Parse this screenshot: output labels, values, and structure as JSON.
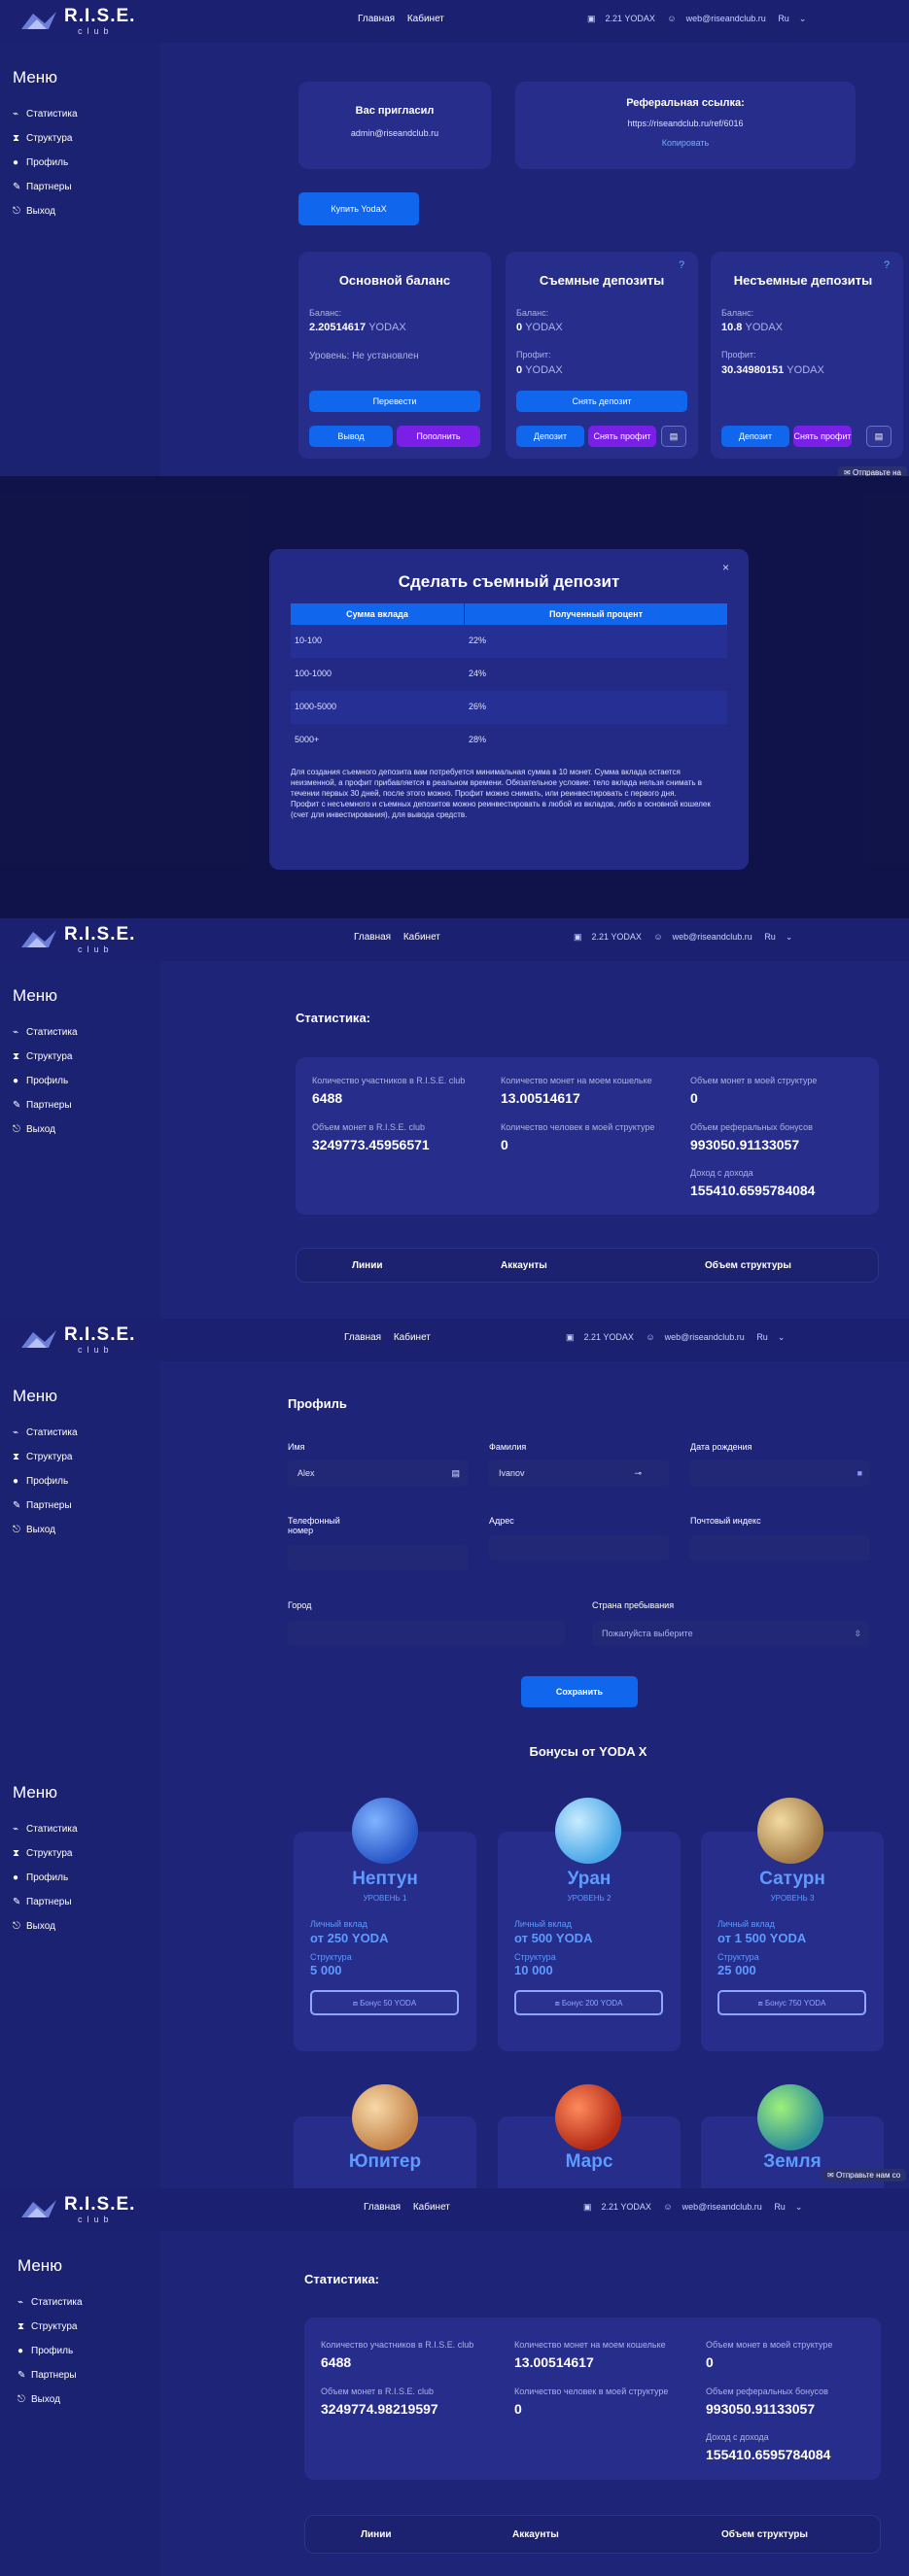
{
  "brand": {
    "name": "R.I.S.E.",
    "sub": "club"
  },
  "nav": {
    "home": "Главная",
    "cabinet": "Кабинет"
  },
  "header": {
    "balance": "2.21 YODAX",
    "email": "web@riseandclub.ru",
    "lang": "Ru"
  },
  "menu": {
    "title": "Меню",
    "items": [
      {
        "label": "Статистика",
        "icon": "chart-icon"
      },
      {
        "label": "Структура",
        "icon": "structure-icon"
      },
      {
        "label": "Профиль",
        "icon": "profile-icon"
      },
      {
        "label": "Партнеры",
        "icon": "partners-icon"
      },
      {
        "label": "Выход",
        "icon": "exit-icon"
      }
    ]
  },
  "cabinet": {
    "invited_title": "Вас пригласил",
    "invited_email": "admin@riseandclub.ru",
    "ref_title": "Реферальная ссылка:",
    "ref_link": "https://riseandclub.ru/ref/6016",
    "copy": "Копировать",
    "buy": "Купить YodaX",
    "main": {
      "title": "Основной баланс",
      "balance_label": "Баланс:",
      "balance": "2.20514617",
      "unit": "YODAX",
      "level": "Уровень: Не установлен",
      "transfer": "Перевести",
      "withdraw": "Вывод",
      "topup": "Пополнить"
    },
    "removable": {
      "title": "Съемные депозиты",
      "balance_label": "Баланс:",
      "balance": "0",
      "profit_label": "Профит:",
      "profit": "0",
      "unit": "YODAX",
      "withdraw_dep": "Снять депозит",
      "deposit": "Депозит",
      "withdraw_profit": "Снять профит"
    },
    "fixed": {
      "title": "Несъемные депозиты",
      "balance_label": "Баланс:",
      "balance": "10.8",
      "profit_label": "Профит:",
      "profit": "30.34980151",
      "unit": "YODAX",
      "deposit": "Депозит",
      "withdraw_profit": "Снять профит"
    },
    "chat": "Отправьте на"
  },
  "modal": {
    "title": "Сделать съемный депозит",
    "col1": "Сумма вклада",
    "col2": "Полученный процент",
    "rows": [
      [
        "10-100",
        "22%"
      ],
      [
        "100-1000",
        "24%"
      ],
      [
        "1000-5000",
        "26%"
      ],
      [
        "5000+",
        "28%"
      ]
    ],
    "text1": "Для создания съемного депозита вам потребуется минимальная сумма в 10 монет. Сумма вклада остается неизменной, а профит прибавляется в реальном времени. Обязательное условие: тело вклада нельзя снимать в течении первых 30 дней, после этого можно. Профит можно снимать, или реинвестировать с первого дня.",
    "text2": "Профит с несъемного и съемных депозитов можно реинвестировать в любой из вкладов, либо в основной кошелек (счет для инвестирования), для вывода средств."
  },
  "stats1": {
    "title": "Статистика:",
    "members_label": "Количество участников в R.I.S.E. club",
    "members": "6488",
    "wallet_label": "Количество монет на моем кошельке",
    "wallet": "13.00514617",
    "struct_coins_label": "Объем монет в моей структуре",
    "struct_coins": "0",
    "club_coins_label": "Объем монет в R.I.S.E. club",
    "club_coins": "3249773.45956571",
    "struct_people_label": "Количество человек в моей структуре",
    "struct_people": "0",
    "ref_bonus_label": "Объем реферальных бонусов",
    "ref_bonus": "993050.91133057",
    "income_label": "Доход с дохода",
    "income": "155410.6595784084",
    "tabs": [
      "Линии",
      "Аккаунты",
      "Объем структуры"
    ]
  },
  "profile": {
    "title": "Профиль",
    "name_label": "Имя",
    "name": "Alex",
    "surname_label": "Фамилия",
    "surname": "Ivanov",
    "birth_label": "Дата рождения",
    "phone_label": "Телефонный номер",
    "address_label": "Адрес",
    "zip_label": "Почтовый индекс",
    "city_label": "Город",
    "country_label": "Страна пребывания",
    "country_placeholder": "Пожалуйста выберите",
    "save": "Сохранить"
  },
  "bonuses": {
    "title": "Бонусы от YODA X",
    "personal_label": "Личный вклад",
    "structure_label": "Структура",
    "planets": [
      {
        "name": "Нептун",
        "level": "УРОВЕНЬ 1",
        "deposit": "от 250 YODA",
        "structure": "5 000",
        "bonus": "Бонус 50 YODA",
        "color": "#3a6fe0"
      },
      {
        "name": "Уран",
        "level": "УРОВЕНЬ 2",
        "deposit": "от 500 YODA",
        "structure": "10 000",
        "bonus": "Бонус 200 YODA",
        "color": "#5ab4f0"
      },
      {
        "name": "Сатурн",
        "level": "УРОВЕНЬ 3",
        "deposit": "от 1 500 YODA",
        "structure": "25 000",
        "bonus": "Бонус 750 YODA",
        "color": "#c9a46a"
      },
      {
        "name": "Юпитер",
        "color": "#e0a862"
      },
      {
        "name": "Марс",
        "color": "#d0452a"
      },
      {
        "name": "Земля",
        "color": "#4caf6a"
      }
    ],
    "chat": "Отправьте нам со"
  },
  "stats2": {
    "title": "Статистика:",
    "club_coins": "3249774.98219597"
  }
}
